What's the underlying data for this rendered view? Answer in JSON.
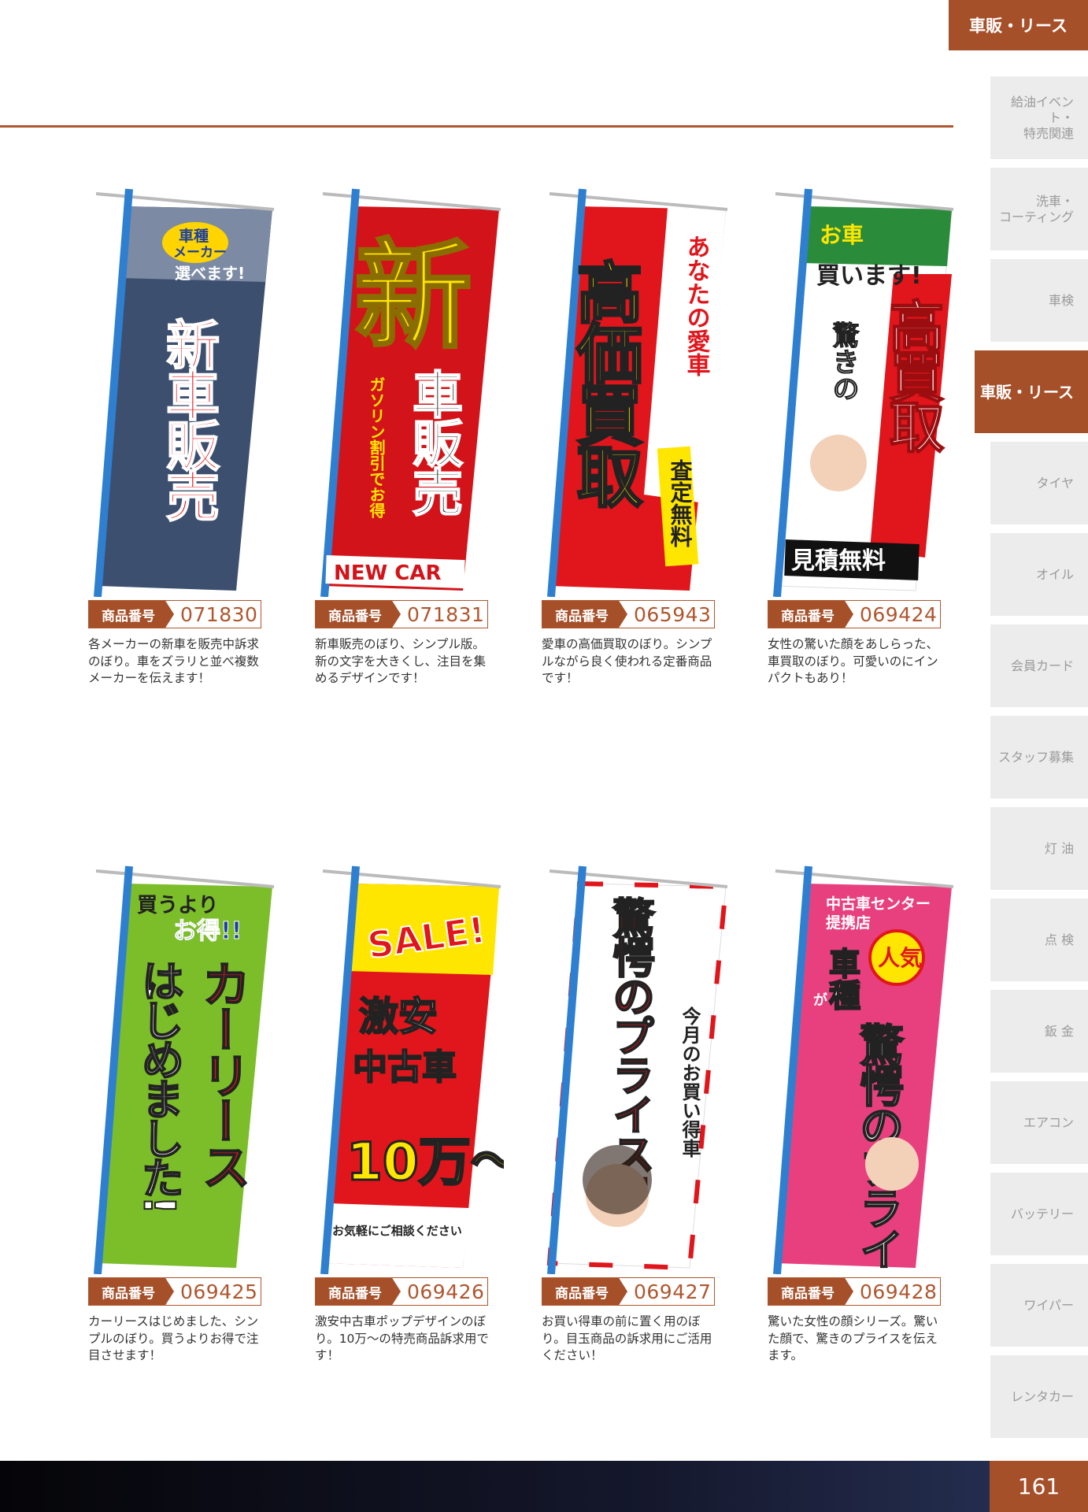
{
  "header": {
    "tab_label": "車販・リース"
  },
  "sidebar": {
    "items": [
      {
        "label": "給油イベント・\n特売関連",
        "active": false
      },
      {
        "label": "洗車・\nコーティング",
        "active": false
      },
      {
        "label": "車検",
        "active": false
      },
      {
        "label": "車販・リース",
        "active": true
      },
      {
        "label": "タイヤ",
        "active": false
      },
      {
        "label": "オイル",
        "active": false
      },
      {
        "label": "会員カード",
        "active": false
      },
      {
        "label": "スタッフ募集",
        "active": false
      },
      {
        "label": "灯 油",
        "active": false
      },
      {
        "label": "点 検",
        "active": false
      },
      {
        "label": "鈑 金",
        "active": false
      },
      {
        "label": "エアコン",
        "active": false
      },
      {
        "label": "バッテリー",
        "active": false
      },
      {
        "label": "ワイパー",
        "active": false
      },
      {
        "label": "レンタカー",
        "active": false
      }
    ]
  },
  "code_label": "商品番号",
  "products": [
    {
      "code": "071830",
      "desc": "各メーカーの新車を販売中訴求のぼり。車をズラリと並べ複数メーカーを伝えます！",
      "banner": {
        "bg": "#3d4f6e",
        "texts": [
          "車種",
          "メーカー",
          "選べます!",
          "新車販売"
        ]
      }
    },
    {
      "code": "071831",
      "desc": "新車販売のぼり、シンプル版。新の文字を大きくし、注目を集めるデザインです！",
      "banner": {
        "bg": "#d2141a",
        "texts": [
          "新",
          "車販売",
          "ガソリン割引でお得",
          "NEW CAR"
        ]
      }
    },
    {
      "code": "065943",
      "desc": "愛車の高価買取のぼり。シンプルながら良く使われる定番商品です！",
      "banner": {
        "bg": "#e0161c",
        "texts": [
          "あなたの愛車",
          "高価買取",
          "査定無料"
        ]
      }
    },
    {
      "code": "069424",
      "desc": "女性の驚いた顔をあしらった、車買取のぼり。可愛いのにインパクトもあり！",
      "banner": {
        "bg": "#ffffff",
        "texts": [
          "お車",
          "買います!",
          "驚きの",
          "高買取",
          "見積無料"
        ]
      }
    },
    {
      "code": "069425",
      "desc": "カーリースはじめました、シンプルのぼり。買うよりお得で注目させます！",
      "banner": {
        "bg": "#7cbd2a",
        "texts": [
          "買うより",
          "お得!!",
          "カーリース",
          "はじめました!"
        ]
      }
    },
    {
      "code": "069426",
      "desc": "激安中古車ポップデザインのぼり。10万～の特売商品訴求用です！",
      "banner": {
        "bg": "#e0161c",
        "texts": [
          "SALE!",
          "激安",
          "中古車",
          "10万～",
          "お気軽にご相談ください"
        ]
      }
    },
    {
      "code": "069427",
      "desc": "お買い得車の前に置く用のぼり。目玉商品の訴求用にご活用ください！",
      "banner": {
        "bg": "#ffffff",
        "texts": [
          "驚愕のプライス!!",
          "今月のお買い得車"
        ]
      }
    },
    {
      "code": "069428",
      "desc": "驚いた女性の顔シリーズ。驚いた顔で、驚きのプライスを伝えます。",
      "banner": {
        "bg": "#e8407f",
        "texts": [
          "中古車センター",
          "提携店",
          "人気",
          "車種",
          "が",
          "驚愕のプライス!"
        ]
      }
    }
  ],
  "footer": {
    "page_number": "161"
  }
}
